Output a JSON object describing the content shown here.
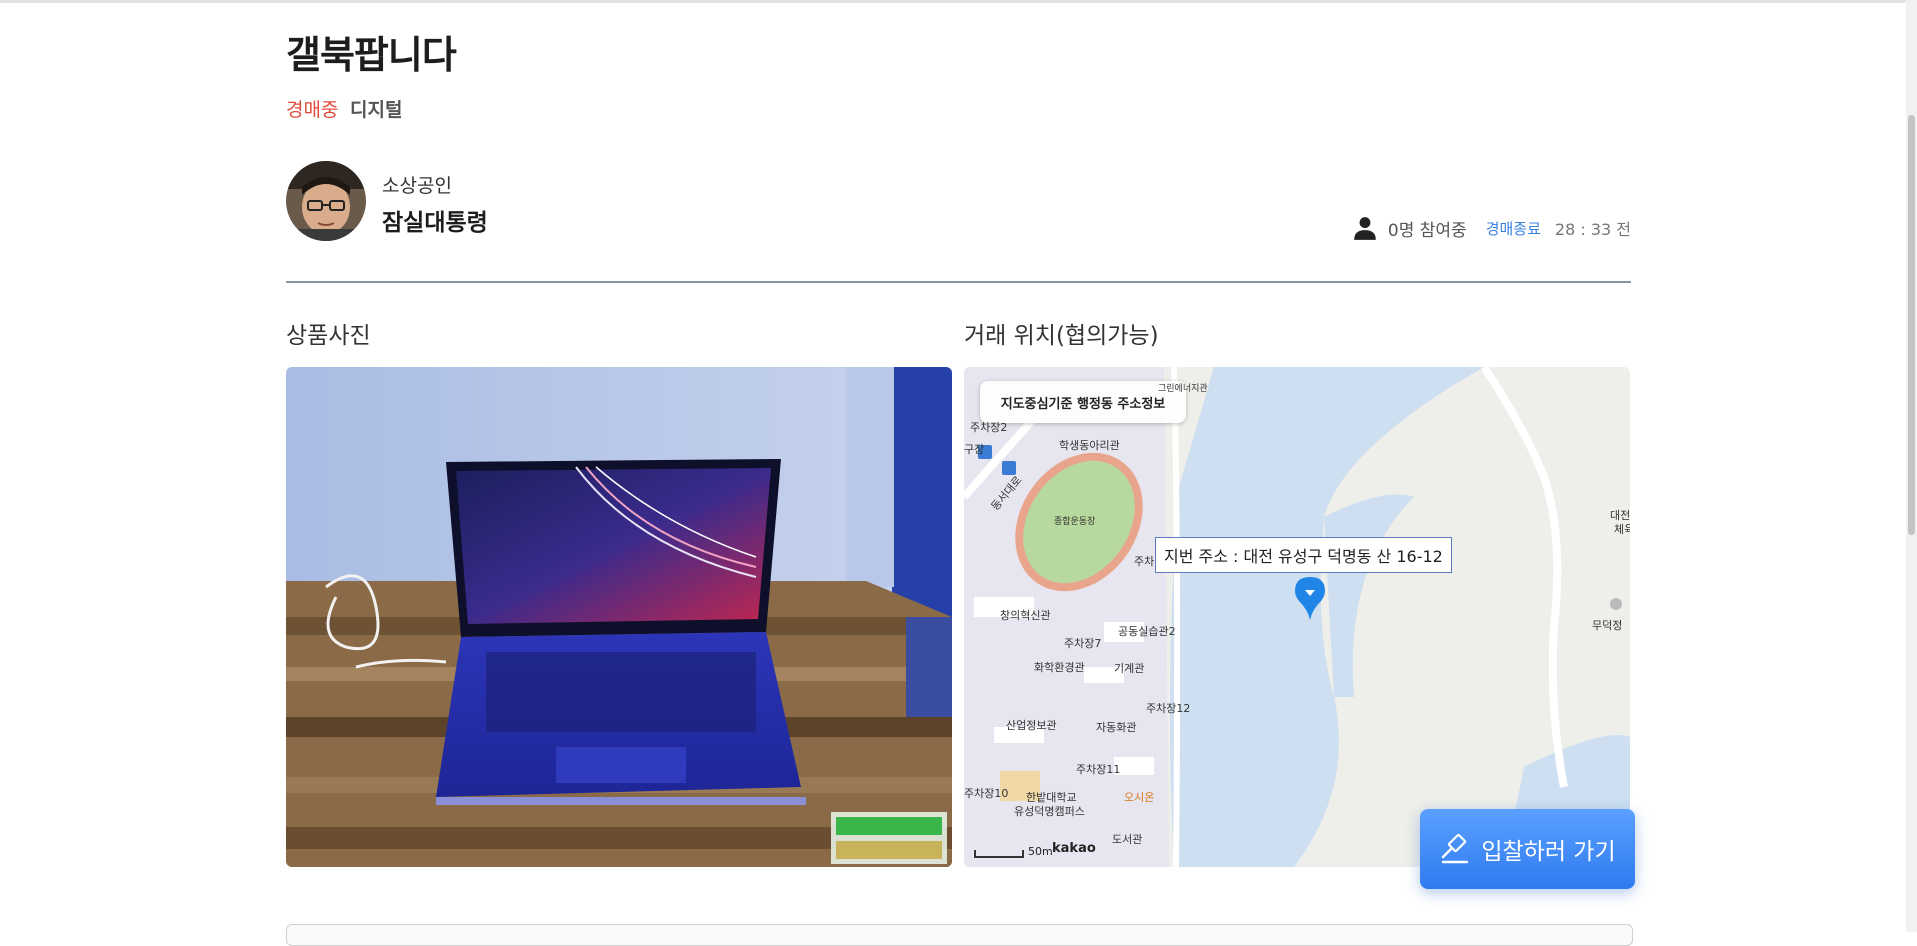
{
  "product": {
    "title": "갤북팝니다",
    "status": "경매중",
    "category": "디지털"
  },
  "seller": {
    "role": "소상공인",
    "name": "잠실대통령"
  },
  "auction": {
    "participants": "0명 참여중",
    "end_label": "경매종료",
    "time_left": "28 : 33 전"
  },
  "sections": {
    "photo_title": "상품사진",
    "location_title": "거래 위치(협의가능)"
  },
  "map": {
    "info_box": "지도중심기준 행정동 주소정보",
    "address_tooltip": "지번 주소 : 대전 유성구 덕명동 산 16-12",
    "scale": "50m",
    "provider": "kakao",
    "labels": {
      "l1": "학생동아리관",
      "l2": "종합운동장",
      "l3": "창의혁신관",
      "l4": "주차장7",
      "l5": "공동실습관2",
      "l6": "화학환경관",
      "l7": "기계관",
      "l8": "주차장12",
      "l9": "산업정보관",
      "l10": "자동화관",
      "l11": "주차장11",
      "l12": "한밭대학교",
      "l13": "유성덕명캠퍼스",
      "l14": "오시온",
      "l15": "도서관",
      "l16": "무덕정",
      "l17": "동서대로",
      "l18": "주차장2",
      "l19": "그린에너지관",
      "l20": "대전",
      "l21": "체육",
      "l22": "주차장10",
      "l23": "구장",
      "l24": "주차"
    }
  },
  "actions": {
    "bid_button": "입찰하러 가기"
  },
  "colors": {
    "status": "#e04a3c",
    "accent": "#3a82e0",
    "bid_button": "#3d8bf7"
  }
}
